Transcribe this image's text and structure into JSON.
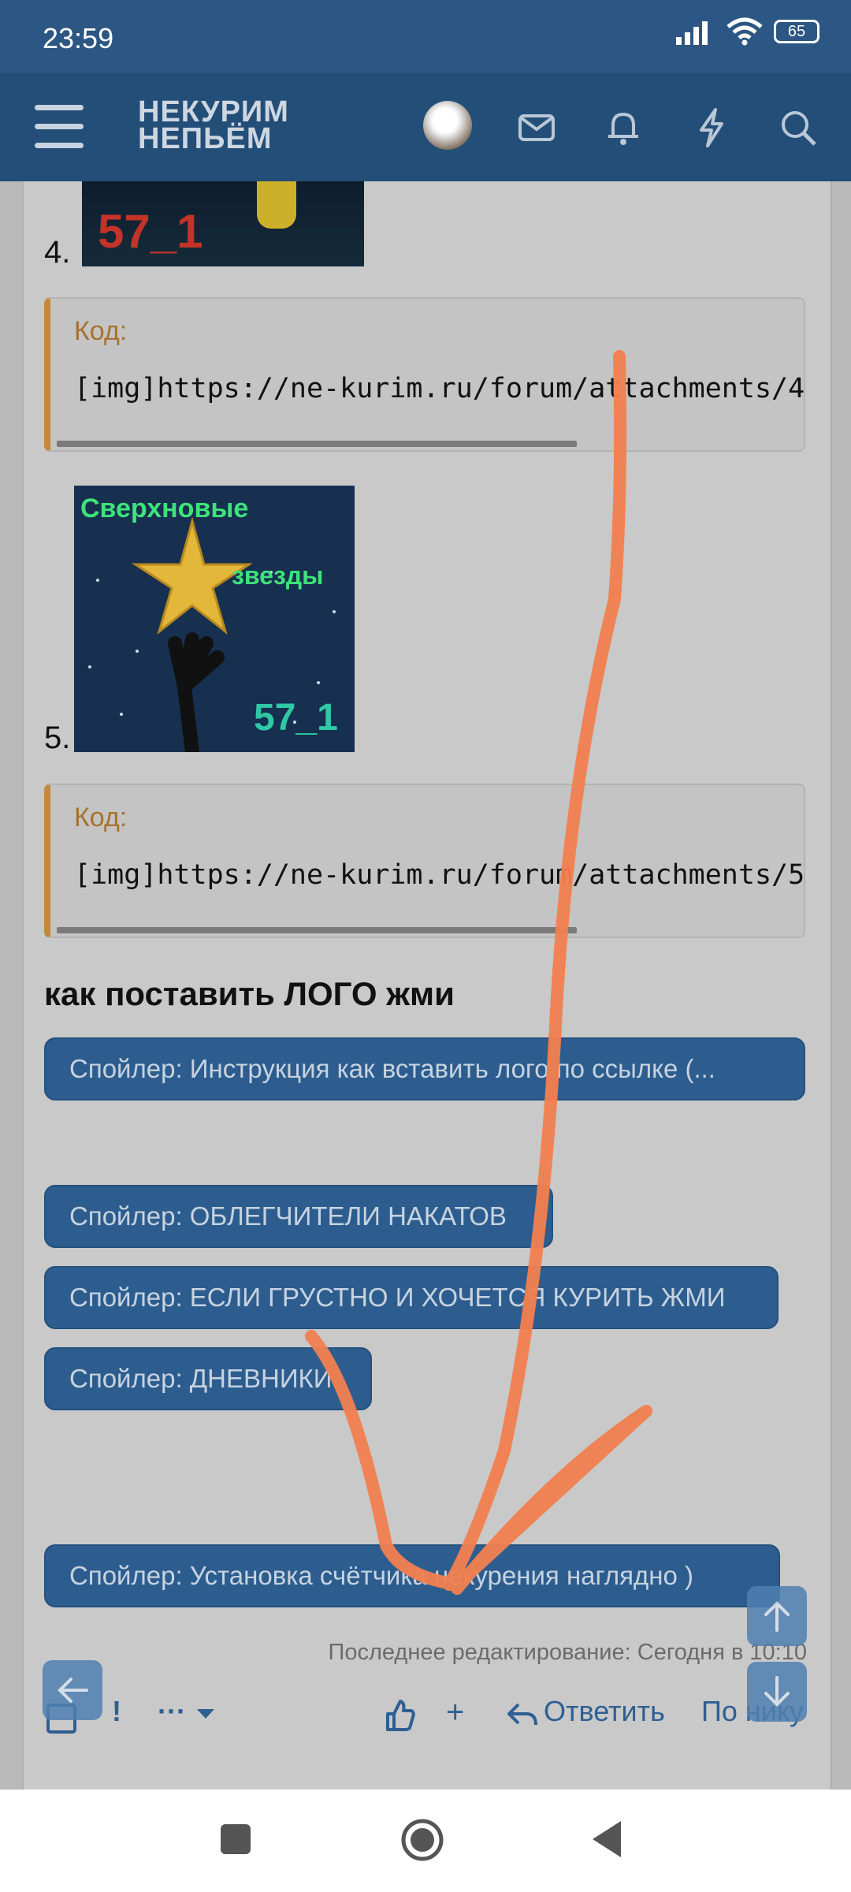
{
  "status_bar": {
    "time": "23:59",
    "battery": "65"
  },
  "top_bar": {
    "logo_line1": "НЕКУРИМ",
    "logo_line2": "НЕПЬЁМ"
  },
  "post": {
    "item4_number": "4.",
    "item4_image_text": "57_1",
    "code_block_1": {
      "label": "Код:",
      "code": "[img]https://ne-kurim.ru/forum/attachments/4"
    },
    "item5_number": "5.",
    "item5_image": {
      "title_line1": "Сверхновые",
      "title_line2": "звезды",
      "tag": "57_1"
    },
    "code_block_2": {
      "label": "Код:",
      "code": "[img]https://ne-kurim.ru/forum/attachments/5"
    },
    "heading": "как поставить ЛОГО жми",
    "spoilers": [
      "Спойлер: Инструкция как вставить лого по ссылке (...",
      "Спойлер: ОБЛЕГЧИТЕЛИ НАКАТОВ",
      "Спойлер: ЕСЛИ ГРУСТНО И ХОЧЕТСЯ КУРИТЬ ЖМИ",
      "Спойлер: ДНЕВНИКИ",
      "Спойлер: Установка счётчика некурения наглядно )"
    ],
    "last_edited": "Последнее редактирование: Сегодня в 10:10"
  },
  "actions": {
    "more": "···",
    "plus": "+",
    "reply": "Ответить",
    "by_nick": "По нику"
  },
  "colors": {
    "header_bg": "#234e78",
    "spoiler_bg": "#2d5d8f",
    "code_accent": "#c28a3a",
    "annotation_stroke": "#f2804f"
  }
}
